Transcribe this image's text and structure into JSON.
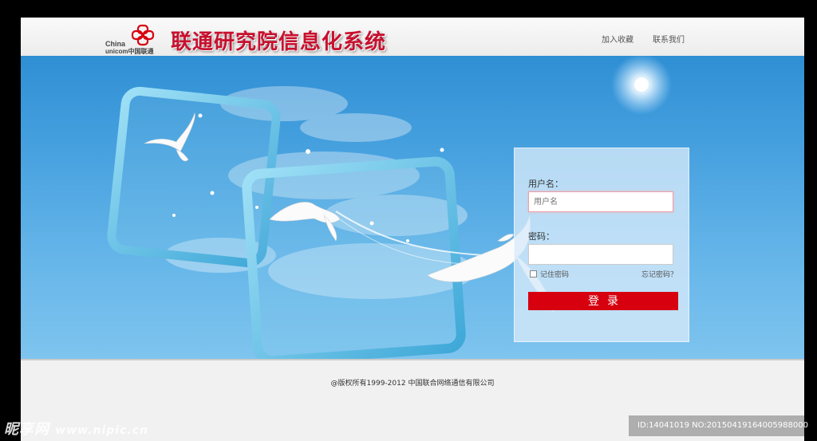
{
  "header": {
    "logo_en_line1": "China",
    "logo_en_line2": "unicom中国联通",
    "system_title": "联通研究院信息化系统",
    "nav": [
      "加入收藏",
      "联系我们"
    ]
  },
  "login": {
    "username_label": "用户名：",
    "username_placeholder": "用户名",
    "password_label": "密码：",
    "remember_label": "记住密码",
    "forgot_label": "忘记密码？",
    "submit_label": "登录"
  },
  "footer": {
    "copyright": "@版权所有1999-2012    中国联合网络通信有限公司"
  },
  "watermark": {
    "left": "昵享网",
    "left_url": "www.nipic.cn",
    "right": "ID:14041019 NO:20150419164005988000"
  },
  "colors": {
    "brand_red": "#c8102e",
    "button_red": "#d7000f",
    "sky_blue": "#4aa3e0"
  }
}
